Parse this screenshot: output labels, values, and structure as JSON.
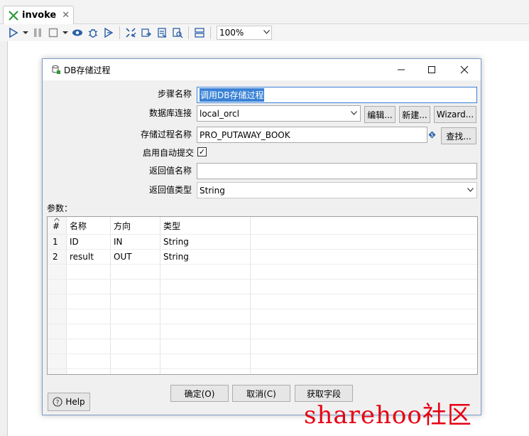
{
  "editor": {
    "tab_title": "invoke",
    "tab_close": "✕",
    "zoom": "100%"
  },
  "toolbar_icons": [
    "run-icon",
    "dropdown-icon",
    "pause-icon",
    "stop-icon",
    "dropdown-icon",
    "preview-icon",
    "debug-icon",
    "replay-icon",
    "verify-icon",
    "impact-icon",
    "sql-icon",
    "explore-db-icon",
    "layout-icon"
  ],
  "dialog": {
    "title": "DB存储过程",
    "minimize": "—",
    "maximize": "☐",
    "close": "✕",
    "step_name_label": "步骤名称",
    "step_name_value": "调用DB存储过程",
    "connection_label": "数据库连接",
    "connection_value": "local_orcl",
    "edit_button": "编辑...",
    "new_button": "新建...",
    "wizard_button": "Wizard...",
    "procedure_label": "存储过程名称",
    "procedure_value": "PRO_PUTAWAY_BOOK",
    "find_button": "查找...",
    "auto_commit_label": "启用自动提交",
    "auto_commit_checked": "✓",
    "return_name_label": "返回值名称",
    "return_name_value": "",
    "return_type_label": "返回值类型",
    "return_type_value": "String",
    "params_label": "参数：",
    "ok_button": "确定(O)",
    "cancel_button": "取消(C)",
    "get_fields_button": "获取字段",
    "help_button": "Help"
  },
  "params_table": {
    "headers": [
      "#",
      "名称",
      "方向",
      "类型"
    ],
    "rows": [
      [
        "1",
        "ID",
        "IN",
        "String"
      ],
      [
        "2",
        "result",
        "OUT",
        "String"
      ]
    ]
  },
  "watermark": "sharehoo社区",
  "colors": {
    "selection": "#3a82d6",
    "dialog_border": "#7a9cc8",
    "watermark": "#e60012",
    "accent_green": "#2e9b3b"
  }
}
